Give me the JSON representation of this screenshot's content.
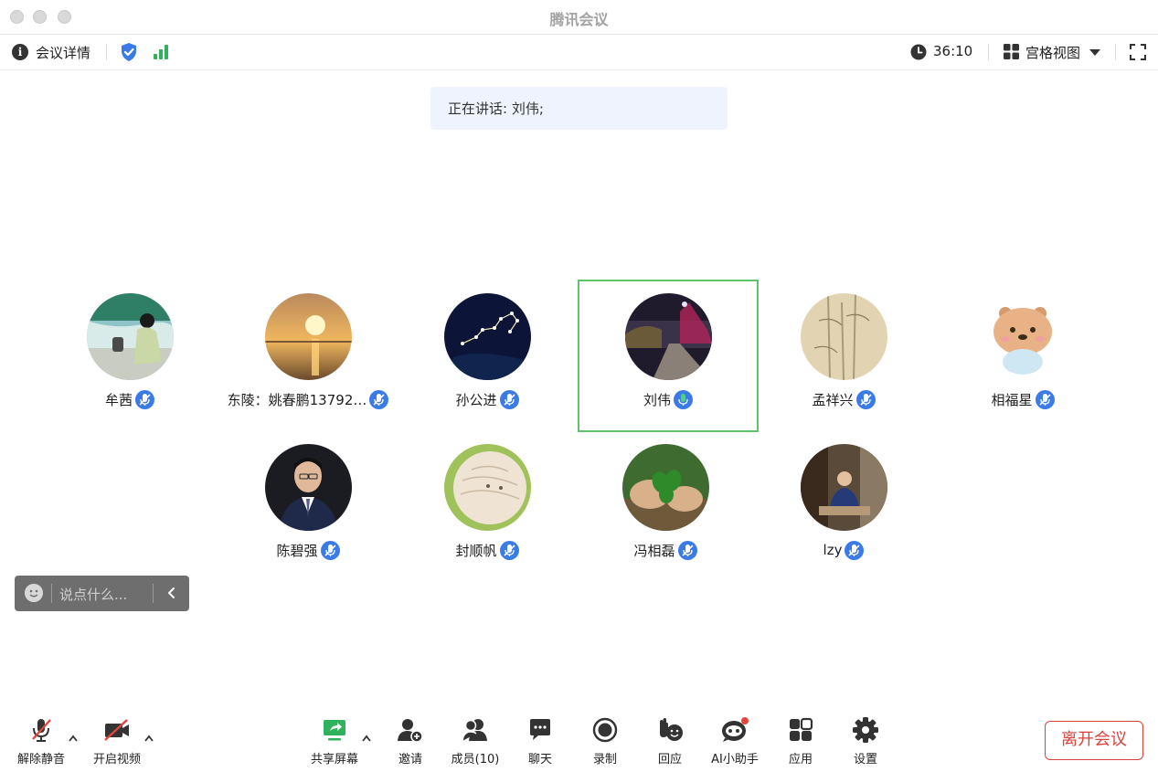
{
  "window": {
    "title": "腾讯会议"
  },
  "infobar": {
    "meeting_details": "会议详情",
    "timer": "36:10",
    "view_mode": "宫格视图"
  },
  "speaking": {
    "text": "正在讲话: 刘伟;"
  },
  "participants": [
    {
      "name": "牟茜",
      "avatar": "beach-girl"
    },
    {
      "name": "东陵：姚春鹏13792…",
      "avatar": "sunset"
    },
    {
      "name": "孙公进",
      "avatar": "constellation"
    },
    {
      "name": "刘伟",
      "avatar": "night-street",
      "speaking": true
    },
    {
      "name": "孟祥兴",
      "avatar": "bamboo-painting"
    },
    {
      "name": "相福星",
      "avatar": "cartoon-bear"
    },
    {
      "name": "陈碧强",
      "avatar": "man-in-suit"
    },
    {
      "name": "封顺帆",
      "avatar": "feather"
    },
    {
      "name": "冯相磊",
      "avatar": "clover"
    },
    {
      "name": "lzy",
      "avatar": "man-at-desk"
    }
  ],
  "chat": {
    "placeholder": "说点什么..."
  },
  "toolbar": {
    "unmute": "解除静音",
    "start_video": "开启视频",
    "share_screen": "共享屏幕",
    "invite": "邀请",
    "members": "成员(10)",
    "chat": "聊天",
    "record": "录制",
    "react": "回应",
    "ai_assistant": "AI小助手",
    "apps": "应用",
    "settings": "设置",
    "leave": "离开会议"
  },
  "colors": {
    "accent": "#3a7be8",
    "speaking_border": "#5ec36a",
    "leave": "#d9413b",
    "signal": "#2fb25b"
  }
}
